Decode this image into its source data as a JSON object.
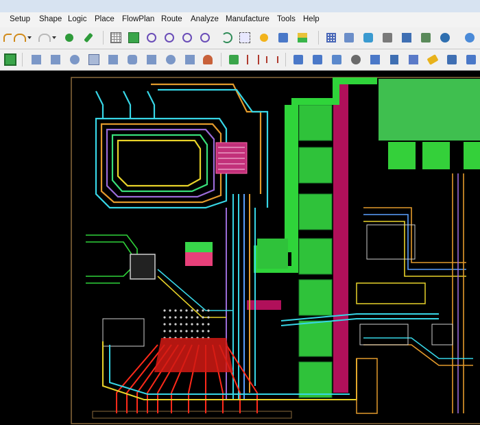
{
  "menu": {
    "items": [
      {
        "label": "Setup"
      },
      {
        "label": "Shape"
      },
      {
        "label": "Logic"
      },
      {
        "label": "Place"
      },
      {
        "label": "FlowPlan"
      },
      {
        "label": "Route"
      },
      {
        "label": "Analyze"
      },
      {
        "label": "Manufacture"
      },
      {
        "label": "Tools"
      },
      {
        "label": "Help"
      }
    ]
  },
  "toolbar_top": {
    "icons": [
      "undo-icon",
      "undo-dropdown-icon",
      "redo-icon",
      "redo-dropdown-icon",
      "add-via-icon",
      "pin-icon",
      "grid-icon",
      "grid-toggle-icon",
      "zoom-fit-icon",
      "zoom-in-icon",
      "zoom-out-icon",
      "zoom-world-icon",
      "zoom-previous-icon",
      "zoom-selection-icon",
      "refresh-icon",
      "layers-icon",
      "color-icon",
      "matrix-icon",
      "show-element-icon",
      "net-icon",
      "rats-icon",
      "stats-icon",
      "3d-view-icon",
      "settings-icon"
    ]
  },
  "toolbar_bottom": {
    "icons": [
      "place-icon",
      "move-icon",
      "rectangle-icon",
      "circle-icon",
      "select-icon",
      "shape-icon",
      "round-icon",
      "square-icon",
      "octagon-icon",
      "text-icon",
      "person-icon",
      "package-icon",
      "dimension-icon",
      "align-icon",
      "swap-icon",
      "assign-icon",
      "copy-icon",
      "delay-icon",
      "mirror-icon",
      "flag-icon",
      "measure-icon",
      "brush-icon",
      "network-icon",
      "matrix-icon",
      "spread-icon"
    ]
  },
  "colors": {
    "menu_accent": "#c8102e",
    "canvas_bg": "#000000",
    "board_outline": "#8a6a3c",
    "copper_green": "#39e639",
    "plane_magenta": "#b0105a",
    "trace_cyan": "#37d6e6",
    "trace_orange": "#e39a2c",
    "trace_red": "#ff2a1a"
  }
}
